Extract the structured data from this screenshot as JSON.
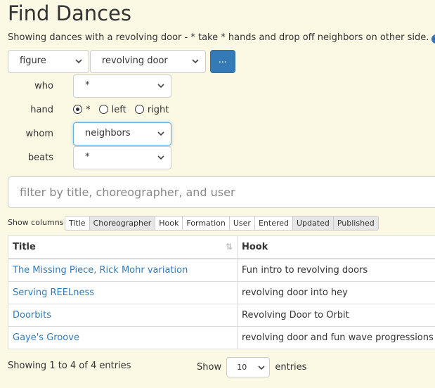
{
  "page": {
    "title": "Find Dances",
    "description": "Showing dances with a revolving door - * take * hands and drop off neighbors on other side.",
    "help_icon": "question-circle-icon"
  },
  "query": {
    "type_select": "figure",
    "figure_select": "revolving door",
    "more_button": "...",
    "params": {
      "who": {
        "label": "who",
        "value": "*"
      },
      "hand": {
        "label": "hand",
        "options": [
          {
            "label": "*",
            "checked": true
          },
          {
            "label": "left",
            "checked": false
          },
          {
            "label": "right",
            "checked": false
          }
        ]
      },
      "whom": {
        "label": "whom",
        "value": "neighbors"
      },
      "beats": {
        "label": "beats",
        "value": "*"
      }
    }
  },
  "filter": {
    "placeholder": "filter by title, choreographer, and user"
  },
  "columns": {
    "label": "Show columns",
    "toggles": [
      {
        "label": "Title",
        "active": true
      },
      {
        "label": "Choreographer",
        "active": false
      },
      {
        "label": "Hook",
        "active": true
      },
      {
        "label": "Formation",
        "active": true
      },
      {
        "label": "User",
        "active": true
      },
      {
        "label": "Entered",
        "active": true
      },
      {
        "label": "Updated",
        "active": false
      },
      {
        "label": "Published",
        "active": false
      }
    ]
  },
  "table": {
    "headers": {
      "title": "Title",
      "hook": "Hook"
    },
    "rows": [
      {
        "title": "The Missing Piece, Rick Mohr variation",
        "hook": "Fun intro to revolving doors"
      },
      {
        "title": "Serving REELness",
        "hook": "revolving door into hey"
      },
      {
        "title": "Doorbits",
        "hook": "Revolving Door to Orbit"
      },
      {
        "title": "Gaye's Groove",
        "hook": "revolving door and fun wave progressions"
      }
    ]
  },
  "footer": {
    "info": "Showing 1 to 4 of 4 entries",
    "show_label": "Show",
    "page_length": "10",
    "entries_label": "entries"
  },
  "colors": {
    "link": "#337ab7",
    "button": "#337ab7",
    "background": "#fbf8e3"
  }
}
